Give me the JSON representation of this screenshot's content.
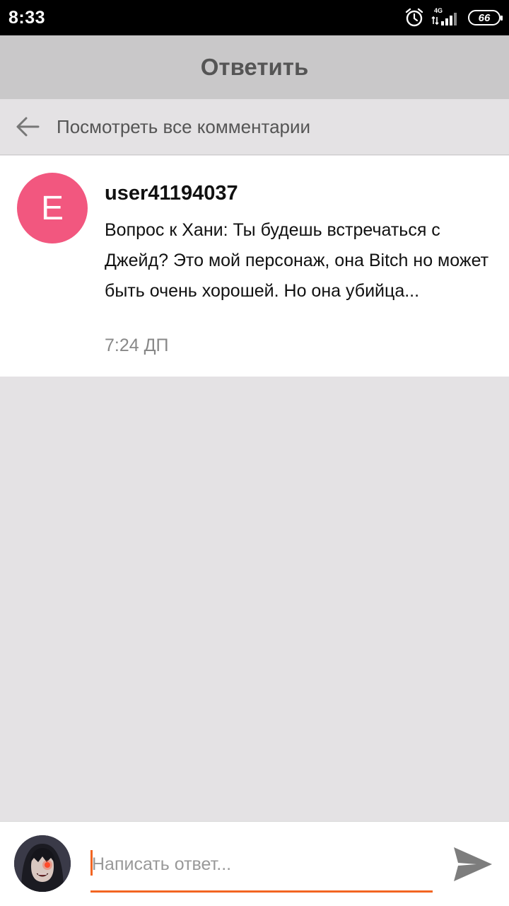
{
  "status_bar": {
    "time": "8:33",
    "network_label": "4G",
    "battery_level": "66",
    "icons": [
      "alarm-icon",
      "signal-icon",
      "battery-icon"
    ]
  },
  "header": {
    "title": "Ответить"
  },
  "view_all": {
    "label": "Посмотреть все комментарии",
    "icon": "back-arrow-icon"
  },
  "comment": {
    "avatar_letter": "E",
    "avatar_color": "#f2577f",
    "author": "user41194037",
    "text": "Вопрос к Хани: Ты будешь встречаться с Джейд? Это мой персонаж, она Bitch но может быть очень хорошей. Но она убийца...",
    "time": "7:24 ДП"
  },
  "reply": {
    "placeholder": "Написать ответ...",
    "value": "",
    "accent_color": "#f26522",
    "send_icon": "send-icon"
  }
}
